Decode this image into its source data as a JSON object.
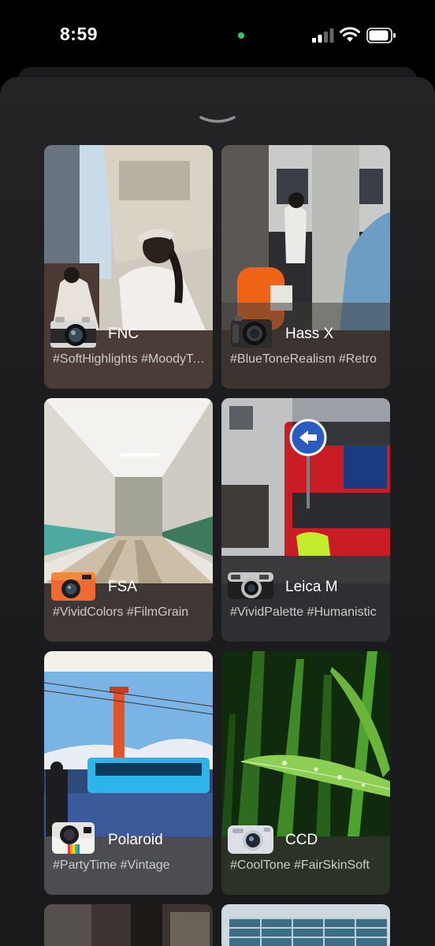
{
  "status_bar": {
    "time": "8:59",
    "icons": [
      "cellular-signal-icon",
      "wifi-icon",
      "battery-icon"
    ],
    "camera_indicator_color": "#34c759"
  },
  "sheet": {
    "grabber_icon": "chevron-down-icon"
  },
  "presets": [
    {
      "name": "FNC",
      "tags": "#SoftHighlights #MoodyTones",
      "camera_icon": "fujifilm-camera-icon",
      "card_color": "#4a3d38"
    },
    {
      "name": "Hass X",
      "tags": "#BlueToneRealism #Retro",
      "camera_icon": "hasselblad-camera-icon",
      "card_color": "#3b3431"
    },
    {
      "name": "FSA",
      "tags": "#VividColors #FilmGrain",
      "camera_icon": "orange-compact-camera-icon",
      "card_color": "#3e3735"
    },
    {
      "name": "Leica M",
      "tags": "#VividPalette #Humanistic",
      "camera_icon": "leica-camera-icon",
      "card_color": "#2e2f33"
    },
    {
      "name": "Polaroid",
      "tags": "#PartyTime #Vintage",
      "camera_icon": "polaroid-camera-icon",
      "card_color": "#4b4d52"
    },
    {
      "name": "CCD",
      "tags": "#CoolTone #FairSkinSoft",
      "camera_icon": "silver-ccd-camera-icon",
      "card_color": "#2a3325"
    }
  ]
}
